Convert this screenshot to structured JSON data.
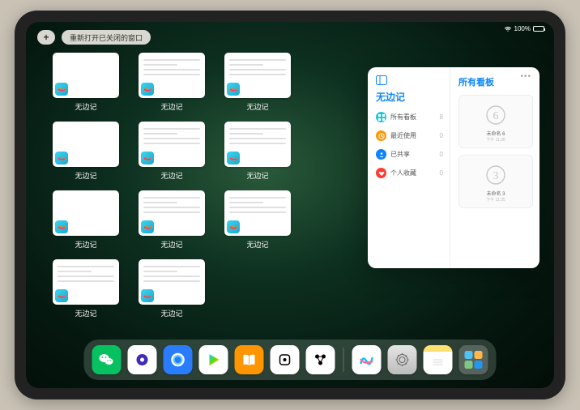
{
  "status": {
    "battery_pct": "100%"
  },
  "topbar": {
    "plus": "+",
    "reopen_label": "重新打开已关闭的窗口"
  },
  "app_switcher": {
    "app_name": "无边记",
    "windows": [
      {
        "label": "无边记",
        "variant": "blank"
      },
      {
        "label": "无边记",
        "variant": "doc"
      },
      {
        "label": "无边记",
        "variant": "doc-stack"
      },
      {
        "label": "无边记",
        "variant": "blank"
      },
      {
        "label": "无边记",
        "variant": "doc"
      },
      {
        "label": "无边记",
        "variant": "doc-stack"
      },
      {
        "label": "无边记",
        "variant": "blank"
      },
      {
        "label": "无边记",
        "variant": "doc"
      },
      {
        "label": "无边记",
        "variant": "doc-stack"
      },
      {
        "label": "无边记",
        "variant": "doc"
      },
      {
        "label": "无边记",
        "variant": "doc-stack"
      }
    ]
  },
  "popover": {
    "left_title": "无边记",
    "items": [
      {
        "icon": "grid",
        "color": "#1fc8db",
        "label": "所有看板",
        "count": "8"
      },
      {
        "icon": "clock",
        "color": "#ff9500",
        "label": "最近使用",
        "count": "0"
      },
      {
        "icon": "people",
        "color": "#0a84ff",
        "label": "已共享",
        "count": "0"
      },
      {
        "icon": "heart",
        "color": "#ff3b30",
        "label": "个人收藏",
        "count": "0"
      }
    ],
    "right_title": "所有看板",
    "boards": [
      {
        "sketch": "6",
        "name": "未命名 6",
        "time": "下午 11:28"
      },
      {
        "sketch": "3",
        "name": "未命名 3",
        "time": "下午 11:25"
      }
    ]
  },
  "dock": {
    "apps": [
      {
        "name": "wechat",
        "bg": "#07c160"
      },
      {
        "name": "quark",
        "bg": "#ffffff"
      },
      {
        "name": "qqbrowser",
        "bg": "#2a7cff"
      },
      {
        "name": "play",
        "bg": "#ffffff"
      },
      {
        "name": "books",
        "bg": "#ff9500"
      },
      {
        "name": "dice",
        "bg": "#ffffff"
      },
      {
        "name": "fitness",
        "bg": "#ffffff"
      },
      {
        "name": "freeform",
        "bg": "#ffffff"
      },
      {
        "name": "settings",
        "bg": "#d9d9d9"
      },
      {
        "name": "notes",
        "bg": "#ffffff"
      },
      {
        "name": "app-library",
        "bg": "#6a8a75"
      }
    ]
  }
}
